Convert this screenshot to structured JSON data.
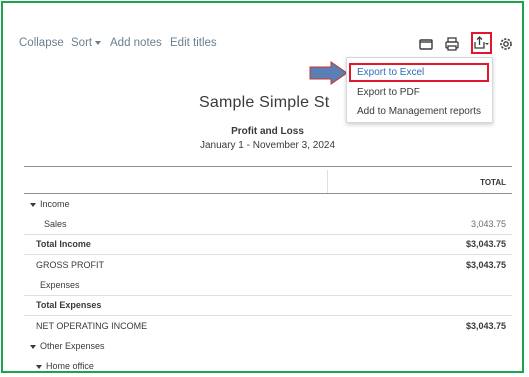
{
  "toolbar": {
    "collapse": "Collapse",
    "sort": "Sort",
    "add_notes": "Add notes",
    "edit_titles": "Edit titles"
  },
  "icons": {
    "email": "email-icon",
    "print": "print-icon",
    "export": "export-icon",
    "settings": "gear-icon"
  },
  "export_menu": {
    "items": [
      "Export to Excel",
      "Export to PDF",
      "Add to Management reports"
    ],
    "highlighted": "Export to Excel"
  },
  "report": {
    "company": "Sample Simple St",
    "title": "Profit and Loss",
    "period": "January 1 - November 3, 2024",
    "column_header": "TOTAL",
    "rows": [
      {
        "label": "Income",
        "value": ""
      },
      {
        "label": "Sales",
        "value": "3,043.75"
      },
      {
        "label": "Total Income",
        "value": "$3,043.75"
      },
      {
        "label": "GROSS PROFIT",
        "value": "$3,043.75"
      },
      {
        "label": "Expenses",
        "value": ""
      },
      {
        "label": "Total Expenses",
        "value": ""
      },
      {
        "label": "NET OPERATING INCOME",
        "value": "$3,043.75"
      },
      {
        "label": "Other Expenses",
        "value": ""
      },
      {
        "label": "Home office",
        "value": ""
      }
    ]
  },
  "colors": {
    "frame_border": "#1ea34a",
    "highlight_red": "#e0182d",
    "arrow_blue": "#5b7fb5",
    "link_gray": "#6b7f8f"
  }
}
